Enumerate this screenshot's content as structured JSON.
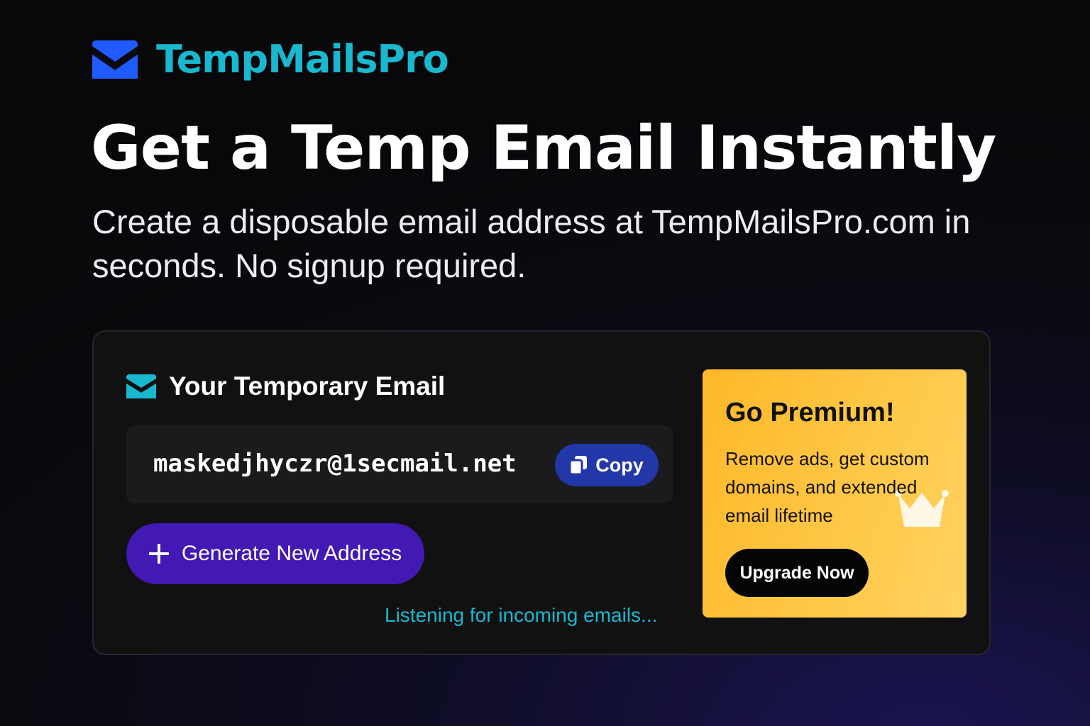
{
  "brand": {
    "name": "TempMailsPro",
    "icon": "envelope-icon",
    "color": "#19b8cf",
    "icon_color": "#1f5bff"
  },
  "hero": {
    "title": "Get a Temp Email Instantly",
    "subtitle": "Create a disposable email address at TempMailsPro.com in seconds. No signup required."
  },
  "email_panel": {
    "header_icon": "envelope-icon",
    "header_title": "Your Temporary Email",
    "address": "maskedjhyczr@1secmail.net",
    "copy_icon": "copy-icon",
    "copy_label": "Copy",
    "generate_icon": "plus-icon",
    "generate_label": "Generate New Address",
    "status": "Listening for incoming emails...",
    "accent_color": "#4219b2",
    "copy_color": "#2237a8"
  },
  "premium": {
    "title": "Go Premium!",
    "description": "Remove ads, get custom domains, and extended email lifetime",
    "button_label": "Upgrade Now",
    "icon": "crown-icon",
    "color": "#fdb828"
  }
}
